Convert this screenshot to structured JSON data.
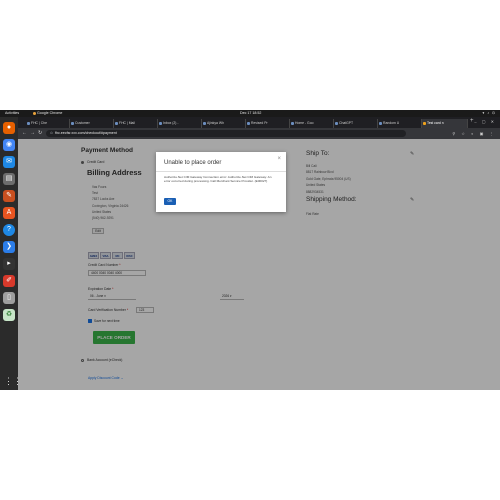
{
  "system": {
    "activities": "Activities",
    "app_name": "Google Chrome",
    "clock": "Dec 17  18:52"
  },
  "browser": {
    "tabs": [
      {
        "label": "FHC | Che"
      },
      {
        "label": "Customer"
      },
      {
        "label": "FHC | Mail"
      },
      {
        "label": "Inbox (2) -"
      },
      {
        "label": "Ajinkya Wh"
      },
      {
        "label": "Revised Pr"
      },
      {
        "label": "Home - Goo"
      },
      {
        "label": "ChatGPT"
      },
      {
        "label": "Random U"
      },
      {
        "label": "Test card n"
      }
    ],
    "url": "fhc.eecfsr.xxx.com/checkout/#payment"
  },
  "checkout": {
    "payment_heading": "Payment Method",
    "credit_card_option": "Credit Card",
    "billing_heading": "Billing Address",
    "billing_address": [
      "Vas Fours",
      "Test",
      "7837 Locks Ave",
      "Covington, Virginia 24426",
      "United States",
      "(540) 962-9291"
    ],
    "edit_label": "Edit",
    "card_brands": [
      "AMEX",
      "VISA",
      "MC",
      "DISC"
    ],
    "cc_label": "Credit Card Number",
    "cc_value": "4400 0040 0040 4000",
    "exp_label": "Expiration Date",
    "exp_month": "06 - June",
    "exp_year": "2026",
    "cvv_label": "Card Verification Number",
    "cvv_value": "123",
    "save_label": "Save for next time",
    "place_order": "PLACE ORDER",
    "bank_option": "Bank Account (eCheck)",
    "discount_label": "Apply Discount Code"
  },
  "summary": {
    "ship_to_heading": "Ship To:",
    "ship_address": [
      "Bill Cali",
      "8817 Rainbow Blvd",
      "Gold Gate, Ephrata 95004 (US)",
      "United States",
      "8882934531"
    ],
    "shipping_method_heading": "Shipping Method:",
    "shipping_method": "Flat Rate"
  },
  "modal": {
    "title": "Unable to place order",
    "message": "Authorize.Net CIM Gateway Connection error: Authorize.Net CIM Gateway: An error occurred during processing. Call Merchant Service Provider. (E00027)",
    "ok_label": "OK",
    "close_glyph": "×"
  }
}
